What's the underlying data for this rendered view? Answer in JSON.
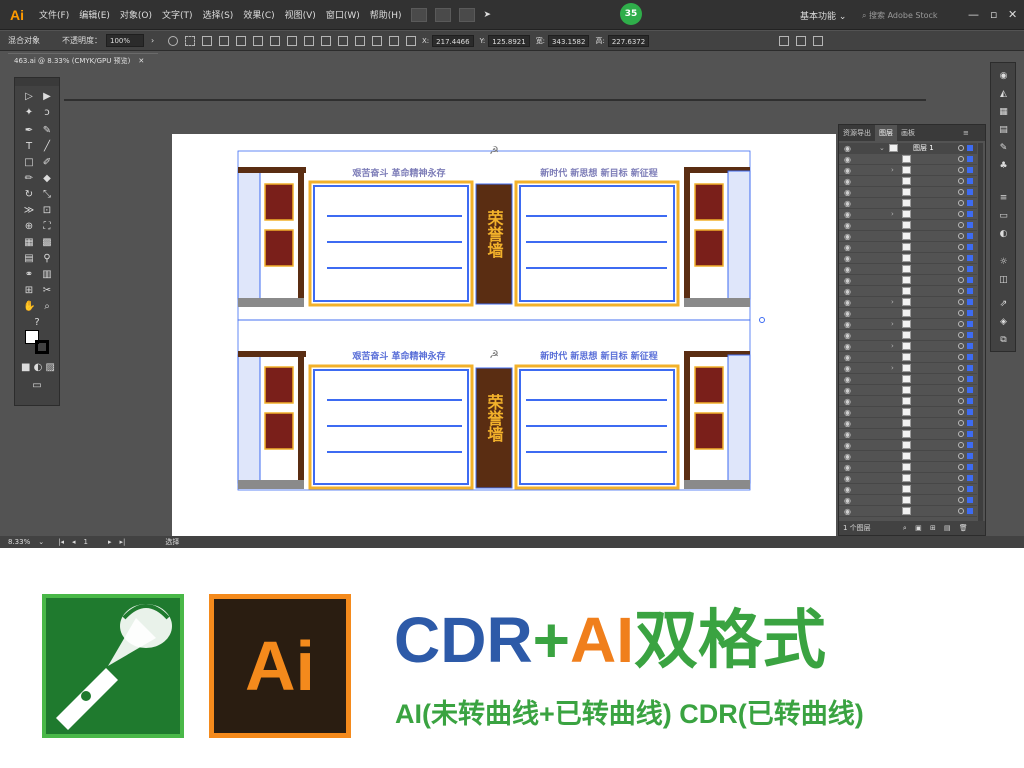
{
  "menubar": {
    "logo": "Ai",
    "items": [
      "文件(F)",
      "编辑(E)",
      "对象(O)",
      "文字(T)",
      "选择(S)",
      "效果(C)",
      "视图(V)",
      "窗口(W)",
      "帮助(H)"
    ],
    "badge": "35",
    "workspace": "基本功能",
    "search_placeholder": "搜索 Adobe Stock"
  },
  "controlbar": {
    "selection_label": "混合对象",
    "opacity_label": "不透明度：",
    "opacity_value": "100%",
    "x_label": "X:",
    "x_value": "217.4466",
    "y_label": "Y:",
    "y_value": "125.8921",
    "w_label": "宽:",
    "w_value": "343.1582",
    "h_label": "高:",
    "h_value": "227.6372"
  },
  "document": {
    "tab_label": "463.ai @ 8.33% (CMYK/GPU 预览)"
  },
  "statusbar": {
    "zoom": "8.33%",
    "page": "1",
    "tool": "选择"
  },
  "layers_panel": {
    "tabs": [
      "资源导出",
      "图层",
      "画板"
    ],
    "top_layer_name": "图层 1",
    "footer": "1 个图层"
  },
  "artwork": {
    "slogan_left": "艰苦奋斗  革命精神永存",
    "slogan_right": "新时代  新思想  新目标  新征程",
    "center_title": "荣誉墙",
    "colors": {
      "blue": "#3d6bf2",
      "gold": "#f2b12b",
      "brown": "#5a2d12",
      "red": "#7a1f1a",
      "gray": "#8a8a8a"
    }
  },
  "promo": {
    "cdr_label": "CDR",
    "plus": "+",
    "ai_label": "AI",
    "format_label": "双格式",
    "ai_logo_text": "Ai",
    "subline": "AI(未转曲线+已转曲线) CDR(已转曲线)",
    "colors": {
      "blue": "#2d5aa8",
      "green": "#3aa341",
      "orange": "#f07f1c"
    }
  }
}
